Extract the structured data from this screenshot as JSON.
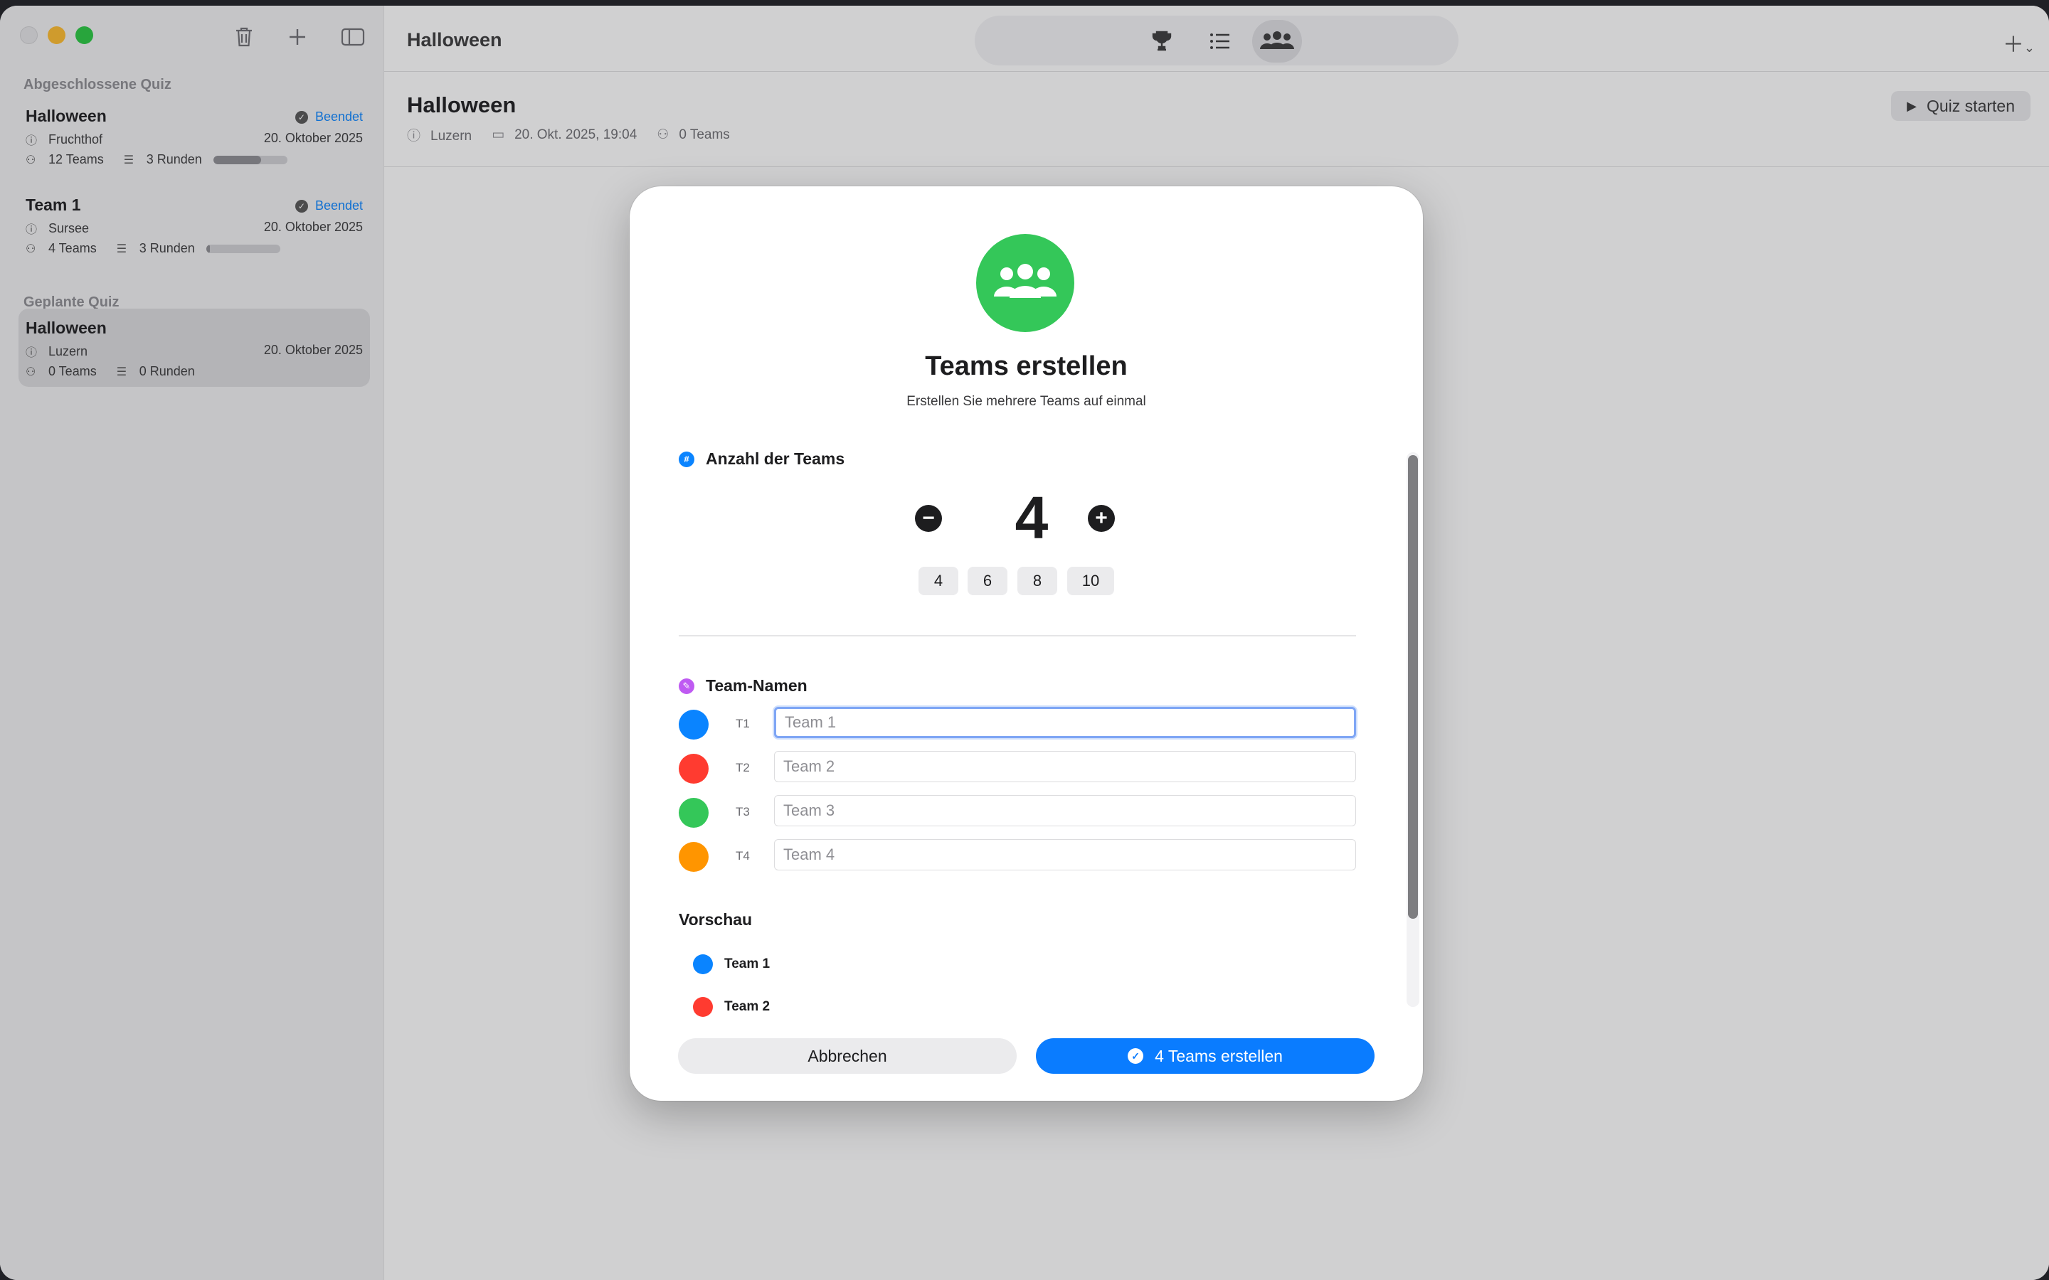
{
  "sidebar": {
    "sections": {
      "completed": "Abgeschlossene Quiz",
      "planned": "Geplante Quiz"
    },
    "quizzes": [
      {
        "title": "Halloween",
        "status": "Beendet",
        "location": "Fruchthof",
        "date": "20. Oktober 2025",
        "teams": "12 Teams",
        "rounds": "3 Runden",
        "progress": 0.65
      },
      {
        "title": "Team 1",
        "status": "Beendet",
        "location": "Sursee",
        "date": "20. Oktober 2025",
        "teams": "4 Teams",
        "rounds": "3 Runden",
        "progress": 0.05
      },
      {
        "title": "Halloween",
        "status": "",
        "location": "Luzern",
        "date": "20. Oktober 2025",
        "teams": "0 Teams",
        "rounds": "0 Runden",
        "progress": null
      }
    ]
  },
  "main": {
    "window_title": "Halloween",
    "detail": {
      "title": "Halloween",
      "location": "Luzern",
      "datetime": "20. Okt. 2025, 19:04",
      "teams": "0 Teams"
    },
    "start_button": "Quiz starten"
  },
  "modal": {
    "title": "Teams erstellen",
    "subtitle": "Erstellen Sie mehrere Teams auf einmal",
    "count_section": "Anzahl der Teams",
    "count_value": "4",
    "presets": [
      "4",
      "6",
      "8",
      "10"
    ],
    "names_section": "Team-Namen",
    "teams": [
      {
        "code": "T1",
        "placeholder": "Team 1",
        "color": "#0a84ff"
      },
      {
        "code": "T2",
        "placeholder": "Team 2",
        "color": "#ff3b30"
      },
      {
        "code": "T3",
        "placeholder": "Team 3",
        "color": "#34c759"
      },
      {
        "code": "T4",
        "placeholder": "Team 4",
        "color": "#ff9500"
      }
    ],
    "preview_title": "Vorschau",
    "preview_items": [
      {
        "name": "Team 1",
        "color": "#0a84ff"
      },
      {
        "name": "Team 2",
        "color": "#ff3b30"
      }
    ],
    "cancel_label": "Abbrechen",
    "create_label": "4 Teams erstellen"
  },
  "colors": {
    "accent": "#0a7cff",
    "hero_green": "#34c759"
  },
  "icons": {
    "trash": "trash-icon",
    "plus": "plus-icon",
    "sidebar": "sidebar-toggle-icon",
    "trophy": "trophy-icon",
    "list": "list-icon",
    "teams": "people-icon"
  }
}
